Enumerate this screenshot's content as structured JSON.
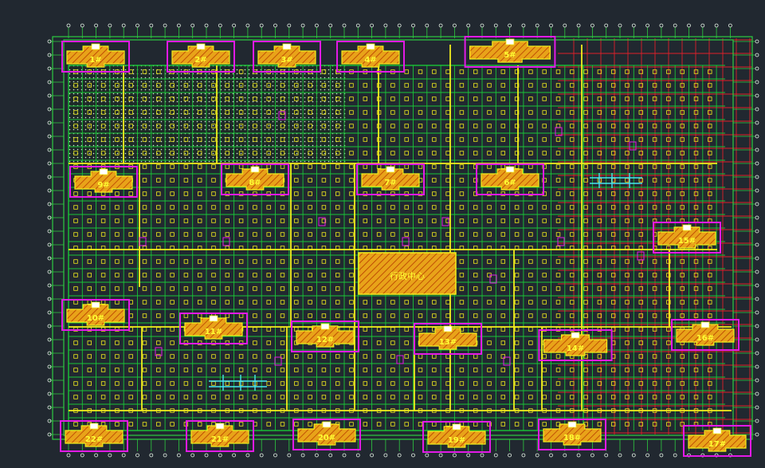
{
  "colors": {
    "background": "#212830",
    "grid_red": "#e0202a",
    "grid_green": "#2ecc40",
    "slab_green": "#19c437",
    "axis_yellow": "#f2ee1c",
    "building_magenta": "#e21ae6",
    "hatch_fill": "#e8a319",
    "hatch_line": "#c23a00",
    "label_yellow": "#ffff33",
    "dot_white": "#e8f5e8"
  },
  "plan": {
    "buildings": [
      {
        "id": "b1",
        "label": "1#"
      },
      {
        "id": "b2",
        "label": "2#"
      },
      {
        "id": "b3",
        "label": "3#"
      },
      {
        "id": "b4",
        "label": "4#"
      },
      {
        "id": "b5",
        "label": "5#"
      },
      {
        "id": "b6",
        "label": "6#"
      },
      {
        "id": "b7",
        "label": "7#"
      },
      {
        "id": "b8",
        "label": "8#"
      },
      {
        "id": "b9",
        "label": "9#"
      },
      {
        "id": "b10",
        "label": "10#"
      },
      {
        "id": "b11",
        "label": "11#"
      },
      {
        "id": "b12",
        "label": "12#"
      },
      {
        "id": "b13",
        "label": "13#"
      },
      {
        "id": "b14",
        "label": "14#"
      },
      {
        "id": "b15",
        "label": "15#"
      },
      {
        "id": "b16",
        "label": "16#"
      },
      {
        "id": "b17",
        "label": "17#"
      },
      {
        "id": "b18",
        "label": "18#"
      },
      {
        "id": "b19",
        "label": "19#"
      },
      {
        "id": "b20",
        "label": "20#"
      },
      {
        "id": "b21",
        "label": "21#"
      },
      {
        "id": "b22",
        "label": "22#"
      }
    ],
    "admin_center_label": "行政中心"
  }
}
